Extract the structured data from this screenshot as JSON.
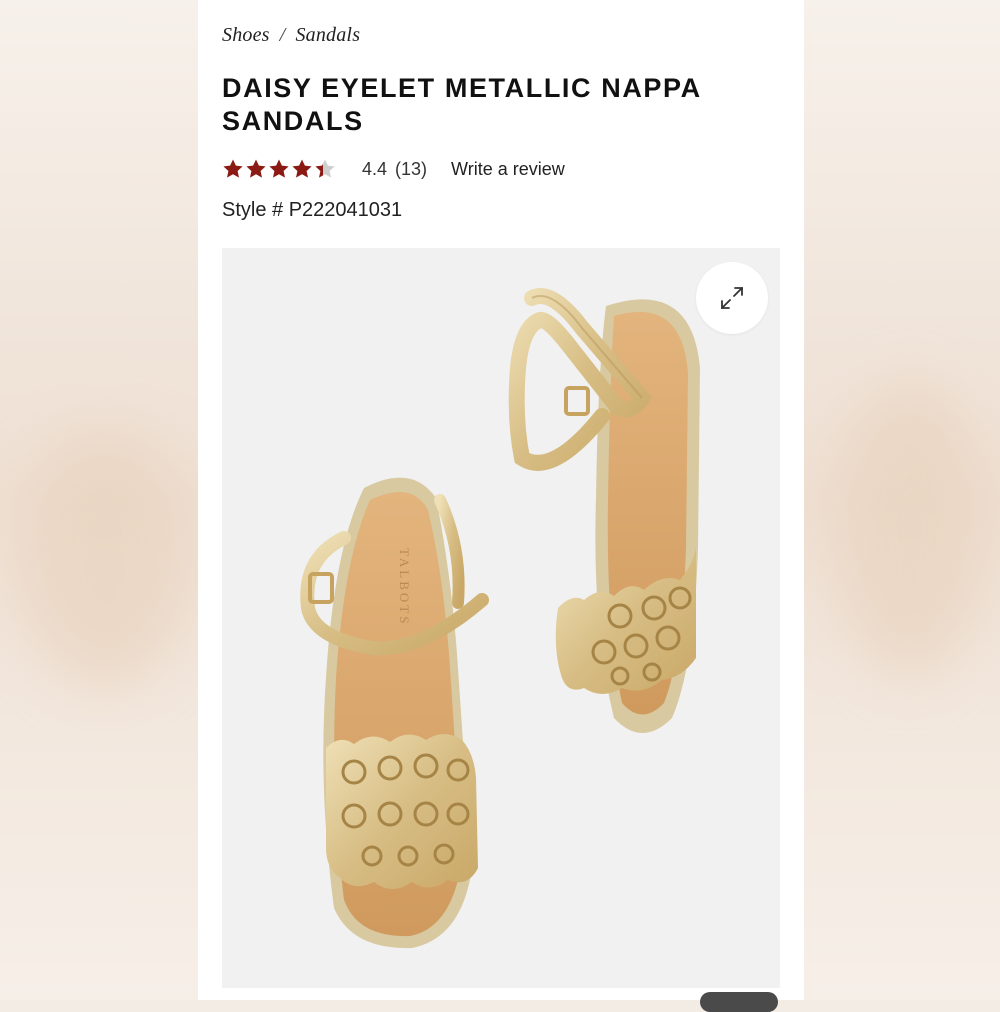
{
  "breadcrumb": {
    "items": [
      "Shoes",
      "Sandals"
    ],
    "separator": "/"
  },
  "product": {
    "title": "DAISY EYELET METALLIC NAPPA SANDALS",
    "rating_value": "4.4",
    "rating_count": "(13)",
    "rating_stars": 4.4,
    "rating_max": 5,
    "review_link": "Write a review",
    "style_label": "Style #",
    "style_number": "P222041031"
  },
  "gallery": {
    "image_brand_marking": "TALBOTS",
    "expand_icon": "expand-arrows-icon"
  },
  "colors": {
    "star": "#8b1a14",
    "star_empty": "#cfcfcf",
    "gold": "#d8c08a",
    "footbed": "#d9a46a"
  }
}
